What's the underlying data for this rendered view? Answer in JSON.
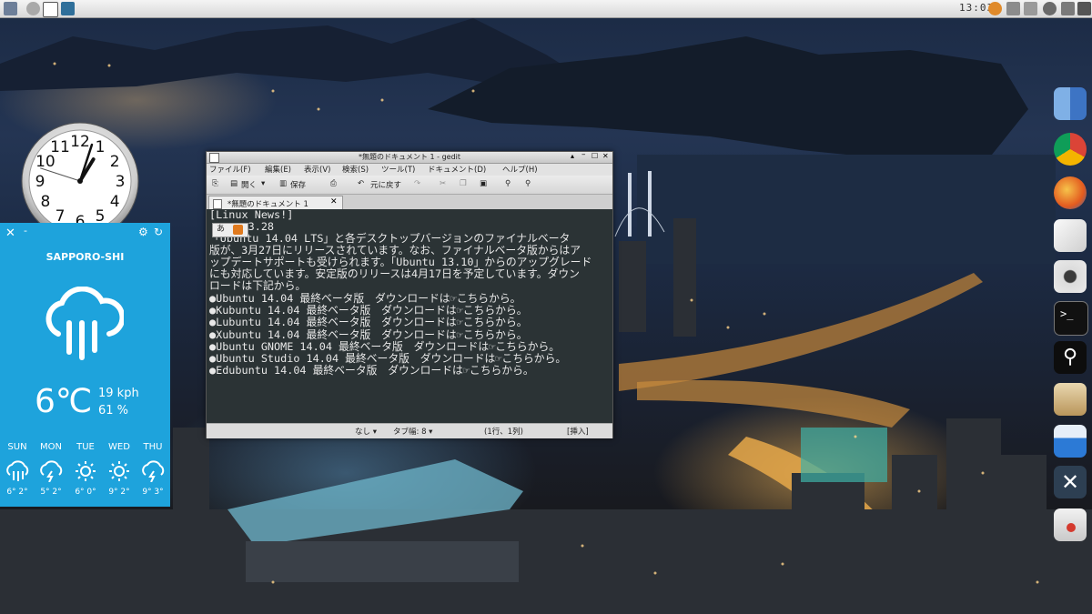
{
  "top_panel": {
    "clock": "13:03",
    "left_icons": [
      "computer-icon",
      "globe-icon",
      "gedit-icon",
      "system-icon"
    ],
    "right_icons": [
      "user-icon",
      "network-icon",
      "volume-icon",
      "power-icon",
      "menu-icon"
    ]
  },
  "clock_widget": {
    "numerals": [
      "12",
      "1",
      "2",
      "3",
      "4",
      "5",
      "6",
      "7",
      "8",
      "9",
      "10",
      "11"
    ],
    "hour": 1,
    "minute": 3,
    "second": 48
  },
  "weather": {
    "city": "SAPPORO-SHI",
    "temperature": "6℃",
    "wind": "19 kph",
    "humidity": "61 %",
    "forecast": [
      {
        "day": "SUN",
        "range": "6° 2°",
        "icon": "rain-icon"
      },
      {
        "day": "MON",
        "range": "5° 2°",
        "icon": "storm-icon"
      },
      {
        "day": "TUE",
        "range": "6° 0°",
        "icon": "sun-icon"
      },
      {
        "day": "WED",
        "range": "9° 2°",
        "icon": "sun-icon"
      },
      {
        "day": "THU",
        "range": "9° 3°",
        "icon": "storm-icon"
      }
    ]
  },
  "gedit": {
    "title": "*無題のドキュメント 1 - gedit",
    "menu": [
      "ファイル(F)",
      "編集(E)",
      "表示(V)",
      "検索(S)",
      "ツール(T)",
      "ドキュメント(D)",
      "ヘルプ(H)"
    ],
    "toolbar": {
      "open": "開く",
      "save": "保存",
      "undo": "元に戻す"
    },
    "tab_label": "*無題のドキュメント 1",
    "ime": "あ",
    "lines": [
      "[Linux News!]",
      "      3.28",
      "「Ubuntu 14.04 LTS」と各デスクトップバージョンのファイナルベータ",
      "版が、3月27日にリリースされています。なお、ファイナルベータ版からはア",
      "ップデートサポートも受けられます。「Ubuntu 13.10」からのアップグレード",
      "にも対応しています。安定版のリリースは4月17日を予定しています。ダウン",
      "ロードは下記から。",
      "●Ubuntu 14.04 最終ベータ版　ダウンロードは☞こちらから。",
      "●Kubuntu 14.04 最終ベータ版　ダウンロードは☞こちらから。",
      "●Lubuntu 14.04 最終ベータ版　ダウンロードは☞こちらから。",
      "●Xubuntu 14.04 最終ベータ版　ダウンロードは☞こちらから。",
      "●Ubuntu GNOME 14.04 最終ベータ版　ダウンロードは☞こちらから。",
      "●Ubuntu Studio 14.04 最終ベータ版　ダウンロードは☞こちらから。",
      "●Edubuntu 14.04 最終ベータ版　ダウンロードは☞こちらから。"
    ],
    "status": {
      "lang": "なし ▾",
      "tab": "タブ幅: 8 ▾",
      "pos": "(1行、1列)",
      "mode": "[挿入]"
    }
  },
  "dock": [
    {
      "name": "finder-icon"
    },
    {
      "name": "chrome-icon"
    },
    {
      "name": "firefox-icon"
    },
    {
      "name": "text-editor-icon"
    },
    {
      "name": "camera-icon"
    },
    {
      "name": "terminal-icon"
    },
    {
      "name": "search-icon"
    },
    {
      "name": "software-icon"
    },
    {
      "name": "app-store-icon"
    },
    {
      "name": "tools-icon"
    },
    {
      "name": "installer-icon"
    }
  ]
}
